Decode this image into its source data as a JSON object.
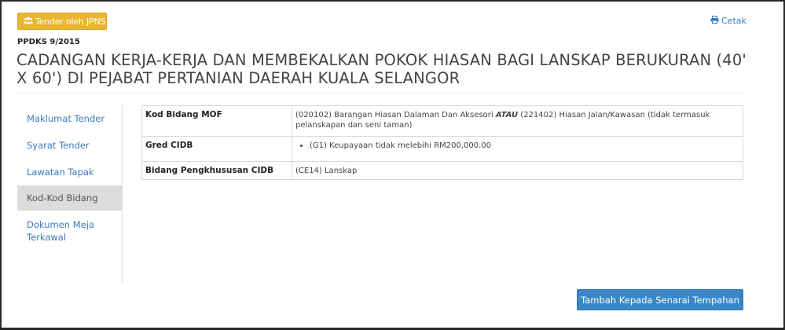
{
  "header": {
    "badge_label": "Tender oleh JPNS",
    "print_label": "Cetak",
    "reference_no": "PPDKS 9/2015",
    "title": "CADANGAN KERJA-KERJA DAN MEMBEKALKAN POKOK HIASAN BAGI LANSKAP BERUKURAN (40' X 60') DI PEJABAT PERTANIAN DAERAH KUALA SELANGOR"
  },
  "sidebar": {
    "items": [
      {
        "label": "Maklumat Tender",
        "active": false
      },
      {
        "label": "Syarat Tender",
        "active": false
      },
      {
        "label": "Lawatan Tapak",
        "active": false
      },
      {
        "label": "Kod-Kod Bidang",
        "active": true
      },
      {
        "label": "Dokumen Meja Terkawal",
        "active": false
      }
    ]
  },
  "codes_table": {
    "mof": {
      "label": "Kod Bidang MOF",
      "part1": "(020102) Barangan Hiasan Dalaman Dan Aksesori ",
      "connector": "ATAU",
      "part2": " (221402) Hiasan Jalan/Kawasan (tidak termasuk pelanskapan dan seni taman)"
    },
    "cidb_grade": {
      "label": "Gred CIDB",
      "items": [
        "(G1) Keupayaan tidak melebihi RM200,000.00"
      ]
    },
    "cidb_specialization": {
      "label": "Bidang Pengkhususan CIDB",
      "value": "(CE14) Lanskap"
    }
  },
  "actions": {
    "add_to_list_label": "Tambah Kepada Senarai Tempahan"
  },
  "colors": {
    "badge": "#e8b630",
    "link": "#3a7abf",
    "primary_button": "#3a87c8",
    "active_nav": "#dcdcdc"
  },
  "icons": {
    "badge_icon": "users-icon",
    "print_icon": "printer-icon"
  }
}
